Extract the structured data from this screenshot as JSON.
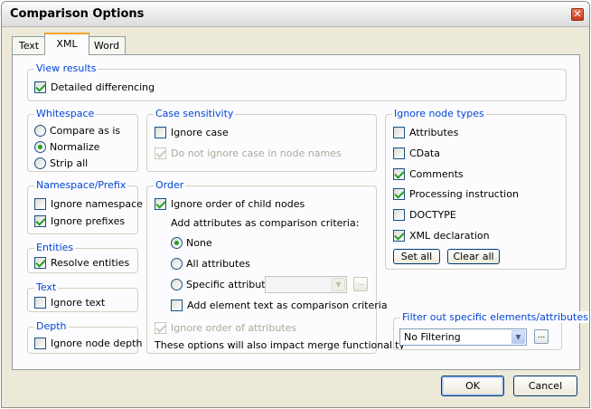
{
  "window": {
    "title": "Comparison Options",
    "close_symbol": "✕"
  },
  "tabs": [
    {
      "label": "Text"
    },
    {
      "label": "XML"
    },
    {
      "label": "Word"
    }
  ],
  "view_results": {
    "legend": "View results",
    "detailed_differencing": "Detailed differencing"
  },
  "whitespace": {
    "legend": "Whitespace",
    "options": [
      "Compare as is",
      "Normalize",
      "Strip all"
    ]
  },
  "namespace": {
    "legend": "Namespace/Prefix",
    "ignore_namespace": "Ignore namespace",
    "ignore_prefixes": "Ignore prefixes"
  },
  "entities": {
    "legend": "Entities",
    "resolve_entities": "Resolve entities"
  },
  "text": {
    "legend": "Text",
    "ignore_text": "Ignore text"
  },
  "depth": {
    "legend": "Depth",
    "ignore_node_depth": "Ignore node depth"
  },
  "case_sensitivity": {
    "legend": "Case sensitivity",
    "ignore_case": "Ignore case",
    "do_not_ignore_node_names": "Do not ignore case in node names"
  },
  "order": {
    "legend": "Order",
    "ignore_child_order": "Ignore order of child nodes",
    "add_attributes_heading": "Add attributes as comparison criteria:",
    "none": "None",
    "all_attributes": "All attributes",
    "specific_attributes": "Specific attributes",
    "specific_attributes_value": "",
    "ellipsis": "...",
    "add_element_text": "Add element text as comparison criteria",
    "ignore_attribute_order": "Ignore order of attributes",
    "note": "These options will also impact merge functionality"
  },
  "node_types": {
    "legend": "Ignore node types",
    "items": [
      "Attributes",
      "CData",
      "Comments",
      "Processing instruction",
      "DOCTYPE",
      "XML declaration"
    ],
    "set_all": "Set all",
    "clear_all": "Clear all"
  },
  "filter": {
    "legend": "Filter out specific elements/attributes",
    "value": "No Filtering",
    "ellipsis": "..."
  },
  "footer": {
    "ok": "OK",
    "cancel": "Cancel"
  }
}
